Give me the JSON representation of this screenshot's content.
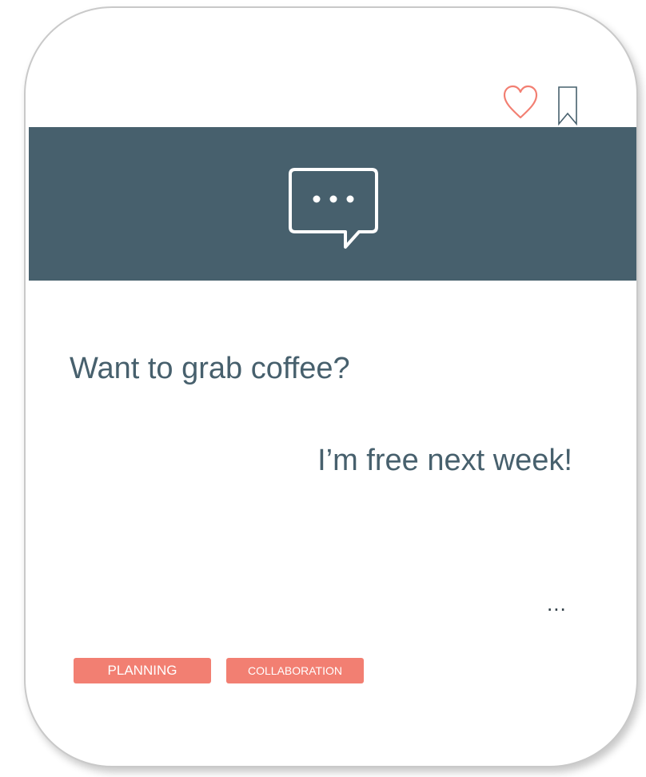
{
  "message": {
    "line1": "Want to grab coffee?",
    "line2": "I’m free next week!"
  },
  "more_label": "...",
  "tags": [
    {
      "label": "PLANNING"
    },
    {
      "label": "COLLABORATION"
    }
  ],
  "colors": {
    "banner": "#47606d",
    "accent": "#f27f72",
    "text": "#47606d"
  },
  "icons": {
    "like": "heart-icon",
    "save": "bookmark-icon",
    "banner": "chat-bubble-icon"
  }
}
